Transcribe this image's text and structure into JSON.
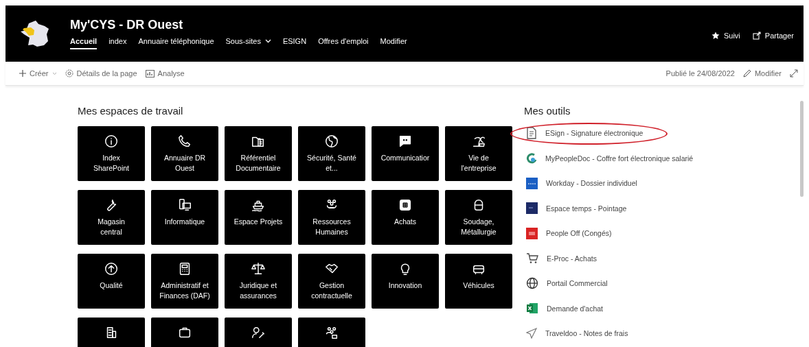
{
  "site": {
    "title": "My'CYS - DR Ouest"
  },
  "nav": [
    {
      "label": "Accueil",
      "selected": true,
      "dropdown": false
    },
    {
      "label": "index",
      "selected": false,
      "dropdown": false
    },
    {
      "label": "Annuaire téléphonique",
      "selected": false,
      "dropdown": false
    },
    {
      "label": "Sous-sites",
      "selected": false,
      "dropdown": true
    },
    {
      "label": "ESIGN",
      "selected": false,
      "dropdown": false
    },
    {
      "label": "Offres d'emploi",
      "selected": false,
      "dropdown": false
    },
    {
      "label": "Modifier",
      "selected": false,
      "dropdown": false
    }
  ],
  "header_actions": [
    {
      "label": "Suivi"
    },
    {
      "label": "Partager"
    }
  ],
  "toolbar": {
    "left": [
      {
        "label": "Créer"
      },
      {
        "label": "Détails de la page"
      },
      {
        "label": "Analyse"
      }
    ],
    "published": "Publié le 24/08/2022",
    "edit": "Modifier"
  },
  "workspaces": {
    "title": "Mes espaces de travail",
    "tiles": [
      {
        "kind": "full",
        "label": "Index SharePoint"
      },
      {
        "kind": "full",
        "label": "Annuaire DR Ouest"
      },
      {
        "kind": "full",
        "label": "Référentiel Documentaire"
      },
      {
        "kind": "full",
        "label": "Sécurité, Santé et..."
      },
      {
        "kind": "full",
        "label": "Communicatior"
      },
      {
        "kind": "full",
        "label": "Vie de l'entreprise"
      },
      {
        "kind": "full",
        "label": "Magasin central"
      },
      {
        "kind": "full",
        "label": "Informatique"
      },
      {
        "kind": "full",
        "label": "Espace Projets"
      },
      {
        "kind": "full",
        "label": "Ressources Humaines"
      },
      {
        "kind": "full",
        "label": "Achats"
      },
      {
        "kind": "full",
        "label": "Soudage, Métallurgie"
      },
      {
        "kind": "full",
        "label": "Qualité"
      },
      {
        "kind": "full",
        "label": "Administratif et Finances (DAF)"
      },
      {
        "kind": "full",
        "label": "Juridique et assurances"
      },
      {
        "kind": "full",
        "label": "Gestion contractuelle"
      },
      {
        "kind": "full",
        "label": "Innovation"
      },
      {
        "kind": "full",
        "label": "Véhicules"
      },
      {
        "kind": "cut"
      },
      {
        "kind": "cut"
      },
      {
        "kind": "cut"
      },
      {
        "kind": "cut"
      }
    ]
  },
  "tools": {
    "title": "Mes outils",
    "items": [
      {
        "label": "ESign - Signature électronique",
        "highlighted": true
      },
      {
        "label": "MyPeopleDoc - Coffre fort électronique salarié",
        "highlighted": false
      },
      {
        "label": "Workday - Dossier individuel",
        "highlighted": false
      },
      {
        "label": "Espace temps - Pointage",
        "highlighted": false
      },
      {
        "label": "People Off (Congés)",
        "highlighted": false
      },
      {
        "label": "E-Proc - Achats",
        "highlighted": false
      },
      {
        "label": "Portail Commercial",
        "highlighted": false
      },
      {
        "label": "Demande d'achat",
        "highlighted": false
      },
      {
        "label": "Traveldoo - Notes de frais",
        "highlighted": false
      }
    ]
  }
}
